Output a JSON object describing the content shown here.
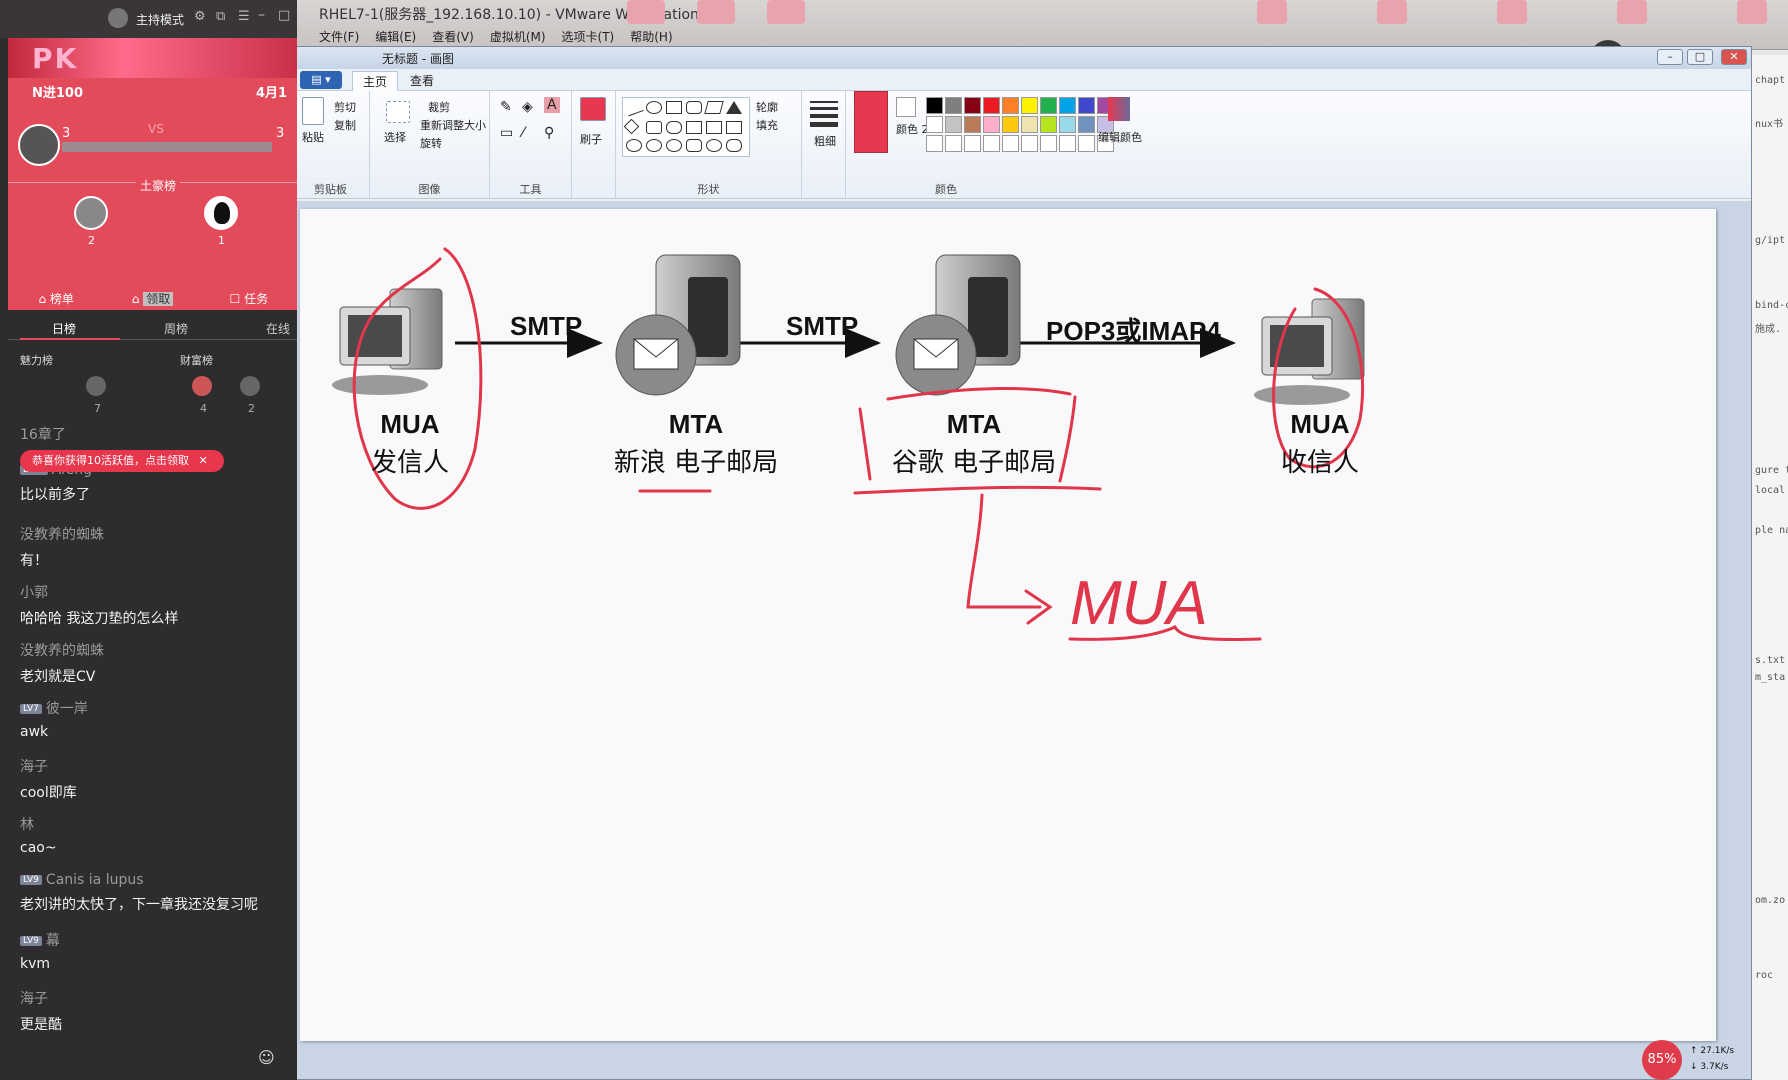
{
  "vmware": {
    "title": "RHEL7-1(服务器_192.168.10.10) - VMware Workstation",
    "menu": [
      "文件(F)",
      "编辑(E)",
      "查看(V)",
      "虚拟机(M)",
      "选项卡(T)",
      "帮助(H)"
    ]
  },
  "paint": {
    "title": "无标题 - 画图",
    "file_tab": "▤ ▾",
    "tabs": [
      "主页",
      "查看"
    ],
    "groups": {
      "clipboard": {
        "label": "剪贴板",
        "paste": "粘贴",
        "cut": "剪切",
        "copy": "复制"
      },
      "image": {
        "label": "图像",
        "select": "选择",
        "crop": "裁剪",
        "resize": "重新调整大小",
        "rotate": "旋转"
      },
      "tools": {
        "label": "工具"
      },
      "brushes": {
        "label": "刷子"
      },
      "shapes": {
        "label": "形状",
        "outline": "轮廓",
        "fill": "填充"
      },
      "size": {
        "label": "粗细"
      },
      "colors": {
        "label": "颜色",
        "color1": "颜色 1",
        "color2": "颜色 2",
        "edit": "编辑颜色"
      }
    },
    "palette": [
      "#000000",
      "#7f7f7f",
      "#880015",
      "#ed1c24",
      "#ff7f27",
      "#fff200",
      "#22b14c",
      "#00a2e8",
      "#3f48cc",
      "#a349a4",
      "#ffffff",
      "#c3c3c3",
      "#b97a57",
      "#ffaec9",
      "#ffc90e",
      "#efe4b0",
      "#b5e61d",
      "#99d9ea",
      "#7092be",
      "#c8bfe7"
    ],
    "accent": "#e8384f"
  },
  "diagram": {
    "nodes": [
      {
        "id": "mua-sender",
        "title": "MUA",
        "sub": "发信人"
      },
      {
        "id": "mta-sina",
        "title": "MTA",
        "sub": "新浪 电子邮局"
      },
      {
        "id": "mta-google",
        "title": "MTA",
        "sub": "谷歌 电子邮局"
      },
      {
        "id": "mua-receiver",
        "title": "MUA",
        "sub": "收信人"
      }
    ],
    "edges": [
      "SMTP",
      "SMTP",
      "POP3或IMAP4"
    ],
    "handwriting": "MUA",
    "ink_color": "#e0364a"
  },
  "stream": {
    "mode": "主持模式",
    "banner_pk": "PK",
    "left_tag": "N进100",
    "date": "4月1",
    "score_left": "3",
    "score_right": "3",
    "vs": "VS",
    "rich_title": "土豪榜",
    "rich_ranks": [
      "2",
      "1"
    ],
    "pk_tabs": [
      "榜单",
      "领取",
      "任务"
    ],
    "rank_tabs": [
      "日榜",
      "周榜",
      "在线"
    ],
    "charm": "魅力榜",
    "wealth": "财富榜",
    "charm_rank": "7",
    "wealth_ranks": [
      "4",
      "2"
    ],
    "toast": "恭喜你获得10活跃值，点击领取",
    "chat": [
      {
        "level": "",
        "user": "16章了",
        "msg": ""
      },
      {
        "level": "LV10",
        "user": "Afeng",
        "msg": "比以前多了"
      },
      {
        "level": "",
        "user": "没教养的蜘蛛",
        "msg": "有！"
      },
      {
        "level": "",
        "user": "小郭",
        "msg": "哈哈哈 我这刀垫的怎么样"
      },
      {
        "level": "",
        "user": "没教养的蜘蛛",
        "msg": "老刘就是CV"
      },
      {
        "level": "LV7",
        "user": "彼一岸",
        "msg": "awk"
      },
      {
        "level": "",
        "user": "海子",
        "msg": "cool即库"
      },
      {
        "level": "",
        "user": "林",
        "msg": "cao~"
      },
      {
        "level": "LV9",
        "user": "Canis ia lupus",
        "msg": "老刘讲的太快了，下一章我还没复习呢"
      },
      {
        "level": "LV9",
        "user": "幕",
        "msg": "kvm"
      },
      {
        "level": "",
        "user": "海子",
        "msg": "更是酷"
      }
    ]
  },
  "net": {
    "cpu": "85%",
    "up": "27.1K/s",
    "down": "3.7K/s"
  }
}
